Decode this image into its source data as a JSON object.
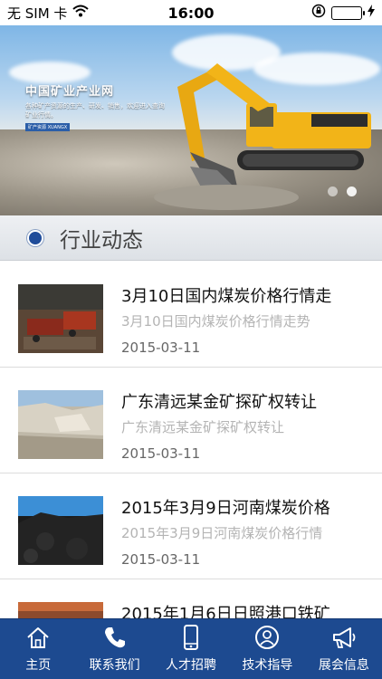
{
  "status_bar": {
    "carrier": "无 SIM 卡",
    "time": "16:00"
  },
  "banner": {
    "title": "中国矿业产业网",
    "description": "各种矿产资源的生产、研发、销售，欢迎进入查询矿业行情。",
    "tag": "矿产资源 XUANGX",
    "page_count": 2,
    "active_page": 2
  },
  "section": {
    "title": "行业动态"
  },
  "news": [
    {
      "title": "3月10日国内煤炭价格行情走",
      "subtitle": "3月10日国内煤炭价格行情走势",
      "date": "2015-03-11",
      "thumb": "coal-trucks"
    },
    {
      "title": "广东清远某金矿探矿权转让",
      "subtitle": "广东清远某金矿探矿权转让",
      "date": "2015-03-11",
      "thumb": "quarry"
    },
    {
      "title": "2015年3月9日河南煤炭价格",
      "subtitle": "2015年3月9日河南煤炭价格行情",
      "date": "2015-03-11",
      "thumb": "coal-pile"
    },
    {
      "title": "2015年1月6日日照港口铁矿",
      "subtitle": "",
      "date": "",
      "thumb": "iron-ore"
    }
  ],
  "tabs": [
    {
      "label": "主页",
      "icon": "home-icon"
    },
    {
      "label": "联系我们",
      "icon": "phone-icon"
    },
    {
      "label": "人才招聘",
      "icon": "mobile-icon"
    },
    {
      "label": "技术指导",
      "icon": "user-circle-icon"
    },
    {
      "label": "展会信息",
      "icon": "megaphone-icon"
    }
  ],
  "colors": {
    "tab_bar": "#1d4a90",
    "accent": "#1f4c9a",
    "battery": "#4cd964"
  }
}
